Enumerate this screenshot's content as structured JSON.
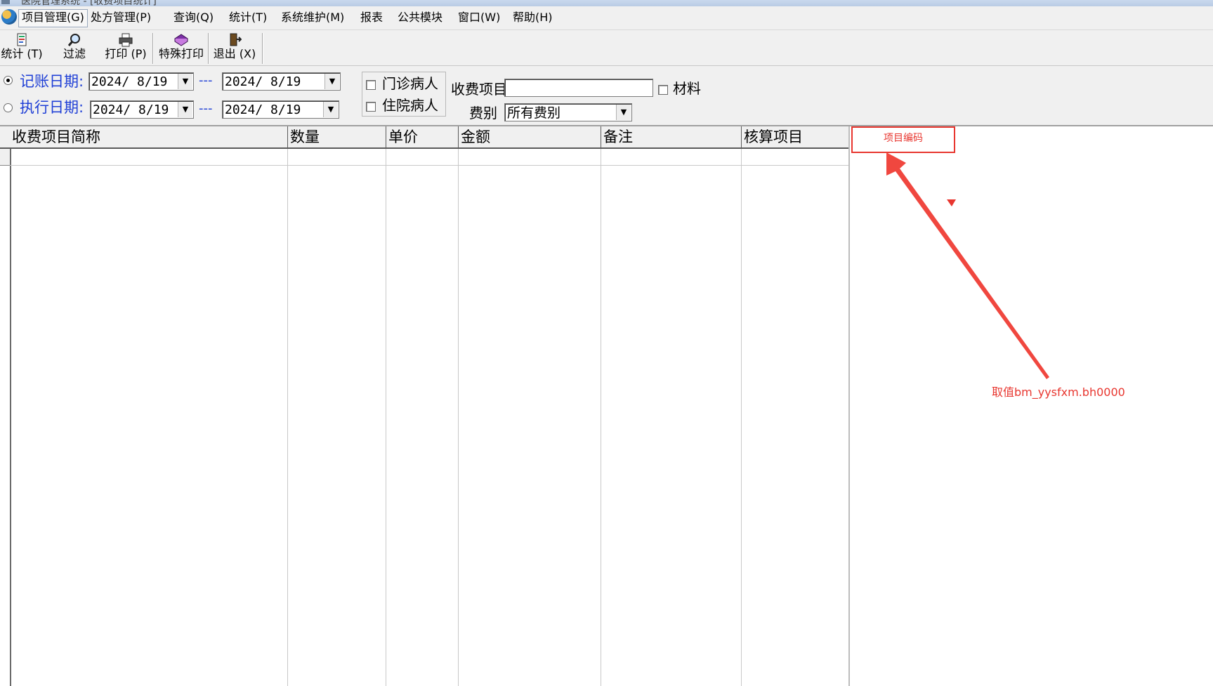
{
  "titlebar": {
    "text": "医院管理系统 - [收费项目统计]"
  },
  "menu": [
    "项目管理(G)",
    "处方管理(P)",
    "查询(Q)",
    "统计(T)",
    "系统维护(M)",
    "报表",
    "公共模块",
    "窗口(W)",
    "帮助(H)"
  ],
  "toolbar": {
    "stats_label": "统计 (T)",
    "filter_label": "过滤",
    "print_label": "打印 (P)",
    "special_print_label": "特殊打印",
    "exit_label": "退出 (X)"
  },
  "filter": {
    "billing_date_label": "记账日期:",
    "exec_date_label": "执行日期:",
    "billing_from": "2024/ 8/19",
    "billing_to": "2024/ 8/19",
    "exec_from": "2024/ 8/19",
    "exec_to": "2024/ 8/19",
    "range_sep": "---",
    "outpatient_label": "门诊病人",
    "inpatient_label": "住院病人",
    "charge_item_label": "收费项目",
    "charge_item_value": "",
    "material_label": "材料",
    "fee_type_label": "费别",
    "fee_type_value": "所有费别"
  },
  "grid": {
    "columns": [
      "收费项目简称",
      "数量",
      "单价",
      "金额",
      "备注",
      "核算项目"
    ]
  },
  "annotation": {
    "box_label": "项目编码",
    "note": "取值bm_yysfxm.bh0000",
    "color": "#e8362f"
  }
}
